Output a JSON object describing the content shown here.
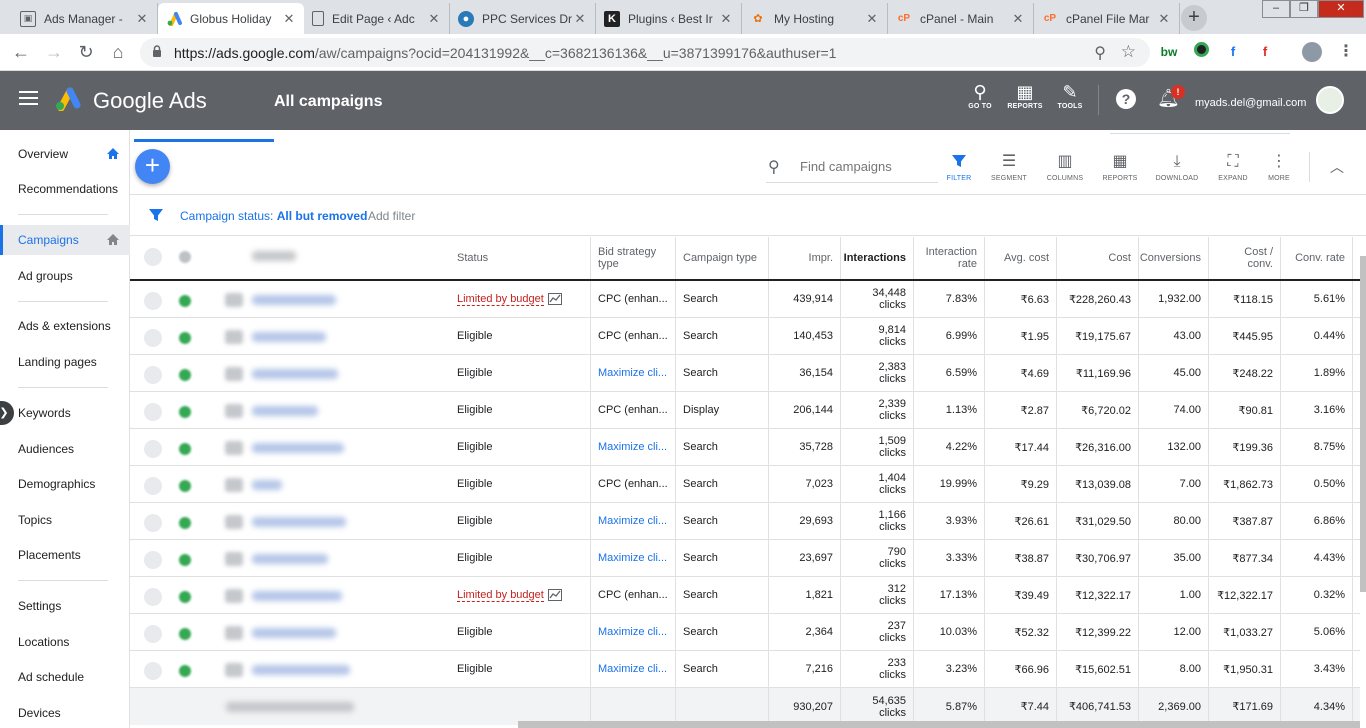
{
  "browser": {
    "tabs": [
      {
        "title": "Ads Manager - ",
        "icon": "ads-manager-icon",
        "active": false
      },
      {
        "title": "Globus Holiday",
        "icon": "google-ads-icon",
        "active": true
      },
      {
        "title": "Edit Page ‹ Adc",
        "icon": "page-icon",
        "active": false
      },
      {
        "title": "PPC Services Dr",
        "icon": "globe-icon",
        "active": false
      },
      {
        "title": "Plugins ‹ Best Ir",
        "icon": "k-icon",
        "active": false
      },
      {
        "title": "My Hosting",
        "icon": "hosting-icon",
        "active": false
      },
      {
        "title": "cPanel - Main",
        "icon": "cpanel-icon",
        "active": false
      },
      {
        "title": "cPanel File Mar",
        "icon": "cpanel-icon",
        "active": false
      }
    ],
    "url_host": "https://ads.google.com",
    "url_rest": "/aw/campaigns?ocid=204131992&__c=3682136136&__u=3871399176&authuser=1"
  },
  "header": {
    "brand": "Google Ads",
    "page_title": "All campaigns",
    "goto_label": "GO TO",
    "reports_label": "REPORTS",
    "tools_label": "TOOLS",
    "notification_count": "!",
    "email": "myads.del@gmail.com"
  },
  "sidebar": {
    "items": [
      {
        "label": "Overview"
      },
      {
        "label": "Recommendations"
      },
      {
        "label": "Campaigns"
      },
      {
        "label": "Ad groups"
      },
      {
        "label": "Ads & extensions"
      },
      {
        "label": "Landing pages"
      },
      {
        "label": "Keywords"
      },
      {
        "label": "Audiences"
      },
      {
        "label": "Demographics"
      },
      {
        "label": "Topics"
      },
      {
        "label": "Placements"
      },
      {
        "label": "Settings"
      },
      {
        "label": "Locations"
      },
      {
        "label": "Ad schedule"
      },
      {
        "label": "Devices"
      }
    ]
  },
  "toolbar": {
    "search_placeholder": "Find campaigns",
    "filter": "FILTER",
    "segment": "SEGMENT",
    "columns": "COLUMNS",
    "reports": "REPORTS",
    "download": "DOWNLOAD",
    "expand": "EXPAND",
    "more": "MORE"
  },
  "filterbar": {
    "label": "Campaign status: ",
    "value": "All but removed",
    "add": "Add filter"
  },
  "table": {
    "headers": {
      "status": "Status",
      "bid": "Bid strategy type",
      "type": "Campaign type",
      "impr": "Impr.",
      "interactions": "Interactions",
      "rate": "Interaction rate",
      "avgcost": "Avg. cost",
      "cost": "Cost",
      "conv": "Conversions",
      "costconv": "Cost / conv.",
      "convrate": "Conv. rate"
    },
    "rows": [
      {
        "status": "Limited by budget",
        "bid": "CPC (enhan...",
        "type": "Search",
        "impr": "439,914",
        "inter": "34,448",
        "unit": "clicks",
        "rate": "7.83%",
        "avg": "₹6.63",
        "cost": "₹228,260.43",
        "conv": "1,932.00",
        "cpc": "₹118.15",
        "cr": "5.61%"
      },
      {
        "status": "Eligible",
        "bid": "CPC (enhan...",
        "type": "Search",
        "impr": "140,453",
        "inter": "9,814",
        "unit": "clicks",
        "rate": "6.99%",
        "avg": "₹1.95",
        "cost": "₹19,175.67",
        "conv": "43.00",
        "cpc": "₹445.95",
        "cr": "0.44%"
      },
      {
        "status": "Eligible",
        "bid": "Maximize cli...",
        "type": "Search",
        "impr": "36,154",
        "inter": "2,383",
        "unit": "clicks",
        "rate": "6.59%",
        "avg": "₹4.69",
        "cost": "₹11,169.96",
        "conv": "45.00",
        "cpc": "₹248.22",
        "cr": "1.89%"
      },
      {
        "status": "Eligible",
        "bid": "CPC (enhan...",
        "type": "Display",
        "impr": "206,144",
        "inter": "2,339",
        "unit": "clicks",
        "rate": "1.13%",
        "avg": "₹2.87",
        "cost": "₹6,720.02",
        "conv": "74.00",
        "cpc": "₹90.81",
        "cr": "3.16%"
      },
      {
        "status": "Eligible",
        "bid": "Maximize cli...",
        "type": "Search",
        "impr": "35,728",
        "inter": "1,509",
        "unit": "clicks",
        "rate": "4.22%",
        "avg": "₹17.44",
        "cost": "₹26,316.00",
        "conv": "132.00",
        "cpc": "₹199.36",
        "cr": "8.75%"
      },
      {
        "status": "Eligible",
        "bid": "CPC (enhan...",
        "type": "Search",
        "impr": "7,023",
        "inter": "1,404",
        "unit": "clicks",
        "rate": "19.99%",
        "avg": "₹9.29",
        "cost": "₹13,039.08",
        "conv": "7.00",
        "cpc": "₹1,862.73",
        "cr": "0.50%"
      },
      {
        "status": "Eligible",
        "bid": "Maximize cli...",
        "type": "Search",
        "impr": "29,693",
        "inter": "1,166",
        "unit": "clicks",
        "rate": "3.93%",
        "avg": "₹26.61",
        "cost": "₹31,029.50",
        "conv": "80.00",
        "cpc": "₹387.87",
        "cr": "6.86%"
      },
      {
        "status": "Eligible",
        "bid": "Maximize cli...",
        "type": "Search",
        "impr": "23,697",
        "inter": "790",
        "unit": "clicks",
        "rate": "3.33%",
        "avg": "₹38.87",
        "cost": "₹30,706.97",
        "conv": "35.00",
        "cpc": "₹877.34",
        "cr": "4.43%"
      },
      {
        "status": "Limited by budget",
        "bid": "CPC (enhan...",
        "type": "Search",
        "impr": "1,821",
        "inter": "312",
        "unit": "clicks",
        "rate": "17.13%",
        "avg": "₹39.49",
        "cost": "₹12,322.17",
        "conv": "1.00",
        "cpc": "₹12,322.17",
        "cr": "0.32%"
      },
      {
        "status": "Eligible",
        "bid": "Maximize cli...",
        "type": "Search",
        "impr": "2,364",
        "inter": "237",
        "unit": "clicks",
        "rate": "10.03%",
        "avg": "₹52.32",
        "cost": "₹12,399.22",
        "conv": "12.00",
        "cpc": "₹1,033.27",
        "cr": "5.06%"
      },
      {
        "status": "Eligible",
        "bid": "Maximize cli...",
        "type": "Search",
        "impr": "7,216",
        "inter": "233",
        "unit": "clicks",
        "rate": "3.23%",
        "avg": "₹66.96",
        "cost": "₹15,602.51",
        "conv": "8.00",
        "cpc": "₹1,950.31",
        "cr": "3.43%"
      }
    ],
    "total": {
      "impr": "930,207",
      "inter": "54,635",
      "unit": "clicks",
      "rate": "5.87%",
      "avg": "₹7.44",
      "cost": "₹406,741.53",
      "conv": "2,369.00",
      "cpc": "₹171.69",
      "cr": "4.34%"
    }
  },
  "colors": {
    "accent": "#1a73e8",
    "header_bg": "#5f6368",
    "limited": "#c5221f",
    "eligible_dot": "#34a853"
  }
}
